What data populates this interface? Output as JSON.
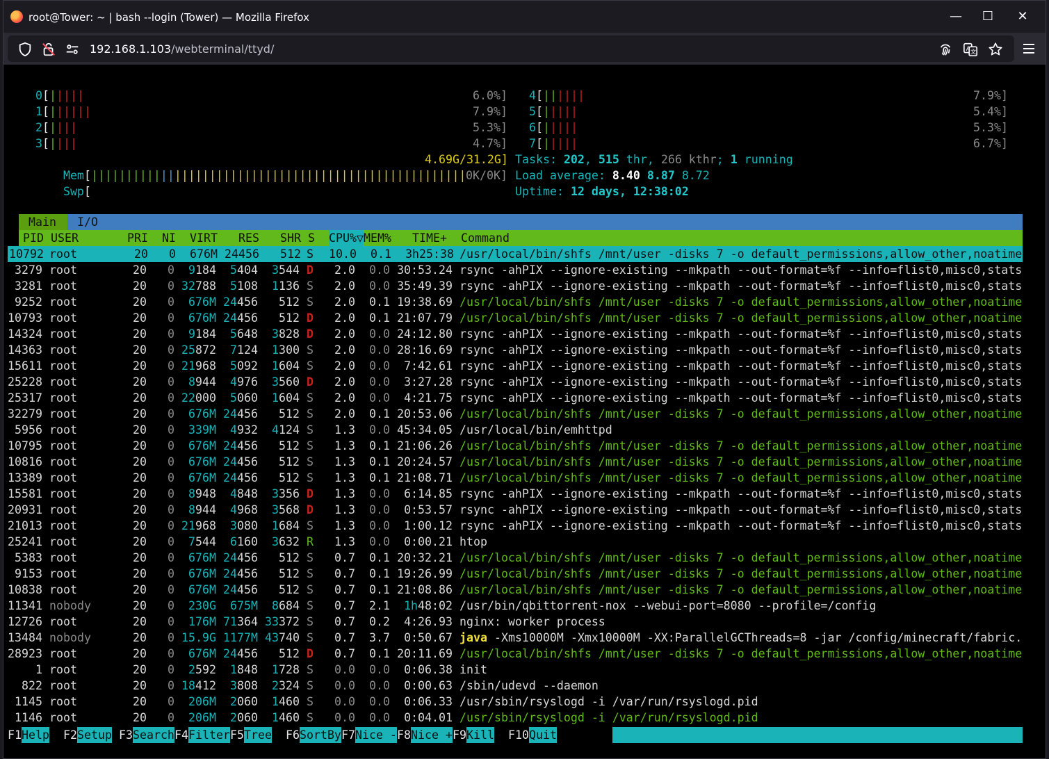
{
  "window": {
    "title": "root@Tower: ~ | bash --login (Tower) — Mozilla Firefox",
    "url_host": "192.168.1.103",
    "url_path": "/webterminal/ttyd/"
  },
  "cpus": [
    {
      "id": "0",
      "bars": [
        {
          "color": "#62b91b",
          "n": 1
        },
        {
          "color": "#c9211c",
          "n": 4
        }
      ],
      "pct": "6.0%]"
    },
    {
      "id": "1",
      "bars": [
        {
          "color": "#62b91b",
          "n": 1
        },
        {
          "color": "#c9211c",
          "n": 5
        }
      ],
      "pct": "7.9%]"
    },
    {
      "id": "2",
      "bars": [
        {
          "color": "#62b91b",
          "n": 1
        },
        {
          "color": "#c9211c",
          "n": 3
        }
      ],
      "pct": "5.3%]"
    },
    {
      "id": "3",
      "bars": [
        {
          "color": "#62b91b",
          "n": 1
        },
        {
          "color": "#c9211c",
          "n": 3
        }
      ],
      "pct": "4.7%]"
    },
    {
      "id": "4",
      "bars": [
        {
          "color": "#62b91b",
          "n": 2
        },
        {
          "color": "#c9211c",
          "n": 4
        }
      ],
      "pct": "7.9%]"
    },
    {
      "id": "5",
      "bars": [
        {
          "color": "#62b91b",
          "n": 1
        },
        {
          "color": "#c9211c",
          "n": 4
        }
      ],
      "pct": "5.4%]"
    },
    {
      "id": "6",
      "bars": [
        {
          "color": "#62b91b",
          "n": 1
        },
        {
          "color": "#c9211c",
          "n": 4
        }
      ],
      "pct": "5.3%]"
    },
    {
      "id": "7",
      "bars": [
        {
          "color": "#62b91b",
          "n": 1
        },
        {
          "color": "#c9211c",
          "n": 4
        }
      ],
      "pct": "6.7%]"
    }
  ],
  "mem": {
    "label": "Mem",
    "bars": [
      {
        "color": "#62b91b",
        "n": 10
      },
      {
        "color": "#4aa3d6",
        "n": 2
      },
      {
        "color": "#dccc1e",
        "n": 42
      }
    ],
    "value": "4.69G/31.2G]"
  },
  "swp": {
    "label": "Swp",
    "value": "0K/0K]"
  },
  "tasks": {
    "label": "Tasks: ",
    "count": "202",
    "sep1": ", ",
    "thr": "515",
    "thr_lbl": " thr, ",
    "kthr": "266 kthr",
    "sep2": "; ",
    "running": "1",
    "running_lbl": " running"
  },
  "load": {
    "label": "Load average: ",
    "v1": "8.40",
    "v2": "8.87",
    "v3": "8.72"
  },
  "uptime": {
    "label": "Uptime: ",
    "value": "12 days, 12:38:02"
  },
  "tabs": {
    "main": "Main",
    "io": "I/O"
  },
  "columns": {
    "pid": "PID",
    "user": "USER",
    "pri": "PRI",
    "ni": "NI",
    "virt": "VIRT",
    "res": "RES",
    "shr": "SHR",
    "s": "S",
    "cpu": "CPU%▽",
    "mem": "MEM%",
    "time": "TIME+",
    "command": "Command"
  },
  "processes": [
    {
      "pid": "10792",
      "user": "root",
      "pri": "20",
      "ni": "0",
      "virt": "676M",
      "res": "24456",
      "shr": "512",
      "s": "S",
      "cpu": "10.0",
      "mem": "0.1",
      "time": "3h25:38",
      "cmd": "/usr/local/bin/shfs /mnt/user -disks 7 -o default_permissions,allow_other,noatime",
      "kind": "thread",
      "selected": true
    },
    {
      "pid": "3279",
      "user": "root",
      "pri": "20",
      "ni": "0",
      "virt": "9184",
      "res": "5404",
      "shr": "3544",
      "s": "D",
      "cpu": "2.0",
      "mem": "0.0",
      "time": "30:53.24",
      "cmd": "rsync -ahPIX --ignore-existing --mkpath --out-format=%f --info=flist0,misc0,stats",
      "kind": "proc"
    },
    {
      "pid": "3281",
      "user": "root",
      "pri": "20",
      "ni": "0",
      "virt": "32788",
      "res": "5108",
      "shr": "1136",
      "s": "S",
      "cpu": "2.0",
      "mem": "0.0",
      "time": "35:49.39",
      "cmd": "rsync -ahPIX --ignore-existing --mkpath --out-format=%f --info=flist0,misc0,stats",
      "kind": "proc"
    },
    {
      "pid": "9252",
      "user": "root",
      "pri": "20",
      "ni": "0",
      "virt": "676M",
      "res": "24456",
      "shr": "512",
      "s": "S",
      "cpu": "2.0",
      "mem": "0.1",
      "time": "19:38.69",
      "cmd": "/usr/local/bin/shfs /mnt/user -disks 7 -o default_permissions,allow_other,noatime",
      "kind": "thread"
    },
    {
      "pid": "10793",
      "user": "root",
      "pri": "20",
      "ni": "0",
      "virt": "676M",
      "res": "24456",
      "shr": "512",
      "s": "D",
      "cpu": "2.0",
      "mem": "0.1",
      "time": "21:07.79",
      "cmd": "/usr/local/bin/shfs /mnt/user -disks 7 -o default_permissions,allow_other,noatime",
      "kind": "thread"
    },
    {
      "pid": "14324",
      "user": "root",
      "pri": "20",
      "ni": "0",
      "virt": "9184",
      "res": "5648",
      "shr": "3828",
      "s": "D",
      "cpu": "2.0",
      "mem": "0.0",
      "time": "24:12.80",
      "cmd": "rsync -ahPIX --ignore-existing --mkpath --out-format=%f --info=flist0,misc0,stats",
      "kind": "proc"
    },
    {
      "pid": "14363",
      "user": "root",
      "pri": "20",
      "ni": "0",
      "virt": "25872",
      "res": "7124",
      "shr": "1300",
      "s": "S",
      "cpu": "2.0",
      "mem": "0.0",
      "time": "28:16.69",
      "cmd": "rsync -ahPIX --ignore-existing --mkpath --out-format=%f --info=flist0,misc0,stats",
      "kind": "proc"
    },
    {
      "pid": "15611",
      "user": "root",
      "pri": "20",
      "ni": "0",
      "virt": "21968",
      "res": "5092",
      "shr": "1604",
      "s": "S",
      "cpu": "2.0",
      "mem": "0.0",
      "time": "7:42.61",
      "cmd": "rsync -ahPIX --ignore-existing --mkpath --out-format=%f --info=flist0,misc0,stats",
      "kind": "proc"
    },
    {
      "pid": "25228",
      "user": "root",
      "pri": "20",
      "ni": "0",
      "virt": "8944",
      "res": "4976",
      "shr": "3560",
      "s": "D",
      "cpu": "2.0",
      "mem": "0.0",
      "time": "3:27.28",
      "cmd": "rsync -ahPIX --ignore-existing --mkpath --out-format=%f --info=flist0,misc0,stats",
      "kind": "proc"
    },
    {
      "pid": "25317",
      "user": "root",
      "pri": "20",
      "ni": "0",
      "virt": "22000",
      "res": "5060",
      "shr": "1604",
      "s": "S",
      "cpu": "2.0",
      "mem": "0.0",
      "time": "4:21.75",
      "cmd": "rsync -ahPIX --ignore-existing --mkpath --out-format=%f --info=flist0,misc0,stats",
      "kind": "proc"
    },
    {
      "pid": "32279",
      "user": "root",
      "pri": "20",
      "ni": "0",
      "virt": "676M",
      "res": "24456",
      "shr": "512",
      "s": "S",
      "cpu": "2.0",
      "mem": "0.1",
      "time": "20:53.06",
      "cmd": "/usr/local/bin/shfs /mnt/user -disks 7 -o default_permissions,allow_other,noatime",
      "kind": "thread"
    },
    {
      "pid": "5956",
      "user": "root",
      "pri": "20",
      "ni": "0",
      "virt": "339M",
      "res": "4932",
      "shr": "4124",
      "s": "S",
      "cpu": "1.3",
      "mem": "0.0",
      "time": "45:34.05",
      "cmd": "/usr/local/bin/emhttpd",
      "kind": "proc"
    },
    {
      "pid": "10795",
      "user": "root",
      "pri": "20",
      "ni": "0",
      "virt": "676M",
      "res": "24456",
      "shr": "512",
      "s": "S",
      "cpu": "1.3",
      "mem": "0.1",
      "time": "21:06.26",
      "cmd": "/usr/local/bin/shfs /mnt/user -disks 7 -o default_permissions,allow_other,noatime",
      "kind": "thread"
    },
    {
      "pid": "10816",
      "user": "root",
      "pri": "20",
      "ni": "0",
      "virt": "676M",
      "res": "24456",
      "shr": "512",
      "s": "S",
      "cpu": "1.3",
      "mem": "0.1",
      "time": "20:24.57",
      "cmd": "/usr/local/bin/shfs /mnt/user -disks 7 -o default_permissions,allow_other,noatime",
      "kind": "thread"
    },
    {
      "pid": "13389",
      "user": "root",
      "pri": "20",
      "ni": "0",
      "virt": "676M",
      "res": "24456",
      "shr": "512",
      "s": "S",
      "cpu": "1.3",
      "mem": "0.1",
      "time": "21:08.71",
      "cmd": "/usr/local/bin/shfs /mnt/user -disks 7 -o default_permissions,allow_other,noatime",
      "kind": "thread"
    },
    {
      "pid": "15581",
      "user": "root",
      "pri": "20",
      "ni": "0",
      "virt": "8948",
      "res": "4848",
      "shr": "3356",
      "s": "D",
      "cpu": "1.3",
      "mem": "0.0",
      "time": "6:14.85",
      "cmd": "rsync -ahPIX --ignore-existing --mkpath --out-format=%f --info=flist0,misc0,stats",
      "kind": "proc"
    },
    {
      "pid": "20931",
      "user": "root",
      "pri": "20",
      "ni": "0",
      "virt": "8944",
      "res": "4968",
      "shr": "3568",
      "s": "D",
      "cpu": "1.3",
      "mem": "0.0",
      "time": "0:53.57",
      "cmd": "rsync -ahPIX --ignore-existing --mkpath --out-format=%f --info=flist0,misc0,stats",
      "kind": "proc"
    },
    {
      "pid": "21013",
      "user": "root",
      "pri": "20",
      "ni": "0",
      "virt": "21968",
      "res": "3080",
      "shr": "1684",
      "s": "S",
      "cpu": "1.3",
      "mem": "0.0",
      "time": "1:00.12",
      "cmd": "rsync -ahPIX --ignore-existing --mkpath --out-format=%f --info=flist0,misc0,stats",
      "kind": "proc"
    },
    {
      "pid": "25241",
      "user": "root",
      "pri": "20",
      "ni": "0",
      "virt": "7544",
      "res": "6160",
      "shr": "3632",
      "s": "R",
      "cpu": "1.3",
      "mem": "0.0",
      "time": "0:00.21",
      "cmd": "htop",
      "kind": "proc"
    },
    {
      "pid": "5383",
      "user": "root",
      "pri": "20",
      "ni": "0",
      "virt": "676M",
      "res": "24456",
      "shr": "512",
      "s": "S",
      "cpu": "0.7",
      "mem": "0.1",
      "time": "20:32.21",
      "cmd": "/usr/local/bin/shfs /mnt/user -disks 7 -o default_permissions,allow_other,noatime",
      "kind": "thread"
    },
    {
      "pid": "9153",
      "user": "root",
      "pri": "20",
      "ni": "0",
      "virt": "676M",
      "res": "24456",
      "shr": "512",
      "s": "S",
      "cpu": "0.7",
      "mem": "0.1",
      "time": "19:26.99",
      "cmd": "/usr/local/bin/shfs /mnt/user -disks 7 -o default_permissions,allow_other,noatime",
      "kind": "thread"
    },
    {
      "pid": "10838",
      "user": "root",
      "pri": "20",
      "ni": "0",
      "virt": "676M",
      "res": "24456",
      "shr": "512",
      "s": "S",
      "cpu": "0.7",
      "mem": "0.1",
      "time": "21:08.86",
      "cmd": "/usr/local/bin/shfs /mnt/user -disks 7 -o default_permissions,allow_other,noatime",
      "kind": "thread"
    },
    {
      "pid": "11341",
      "user": "nobody",
      "pri": "20",
      "ni": "0",
      "virt": "230G",
      "res": "675M",
      "shr": "8684",
      "s": "S",
      "cpu": "0.7",
      "mem": "2.1",
      "time": "1h48:02",
      "cmd": "/usr/bin/qbittorrent-nox --webui-port=8080 --profile=/config",
      "kind": "proc"
    },
    {
      "pid": "12726",
      "user": "root",
      "pri": "20",
      "ni": "0",
      "virt": "176M",
      "res": "71364",
      "shr": "33372",
      "s": "S",
      "cpu": "0.7",
      "mem": "0.2",
      "time": "4:26.93",
      "cmd": "nginx: worker process",
      "kind": "proc"
    },
    {
      "pid": "13484",
      "user": "nobody",
      "pri": "20",
      "ni": "0",
      "virt": "15.9G",
      "res": "1177M",
      "shr": "43740",
      "s": "S",
      "cpu": "0.7",
      "mem": "3.7",
      "time": "0:50.67",
      "cmd": "java",
      "cmd_rest": " -Xms10000M -Xmx10000M -XX:ParallelGCThreads=8 -jar /config/minecraft/fabric.",
      "kind": "java"
    },
    {
      "pid": "28923",
      "user": "root",
      "pri": "20",
      "ni": "0",
      "virt": "676M",
      "res": "24456",
      "shr": "512",
      "s": "D",
      "cpu": "0.7",
      "mem": "0.1",
      "time": "20:11.69",
      "cmd": "/usr/local/bin/shfs /mnt/user -disks 7 -o default_permissions,allow_other,noatime",
      "kind": "thread"
    },
    {
      "pid": "1",
      "user": "root",
      "pri": "20",
      "ni": "0",
      "virt": "2592",
      "res": "1848",
      "shr": "1728",
      "s": "S",
      "cpu": "0.0",
      "mem": "0.0",
      "time": "0:06.38",
      "cmd": "init",
      "kind": "proc"
    },
    {
      "pid": "822",
      "user": "root",
      "pri": "20",
      "ni": "0",
      "virt": "18412",
      "res": "3808",
      "shr": "2324",
      "s": "S",
      "cpu": "0.0",
      "mem": "0.0",
      "time": "0:00.63",
      "cmd": "/sbin/udevd --daemon",
      "kind": "proc"
    },
    {
      "pid": "1145",
      "user": "root",
      "pri": "20",
      "ni": "0",
      "virt": "206M",
      "res": "2060",
      "shr": "1460",
      "s": "S",
      "cpu": "0.0",
      "mem": "0.0",
      "time": "0:06.33",
      "cmd": "/usr/sbin/rsyslogd -i /var/run/rsyslogd.pid",
      "kind": "proc"
    },
    {
      "pid": "1146",
      "user": "root",
      "pri": "20",
      "ni": "0",
      "virt": "206M",
      "res": "2060",
      "shr": "1460",
      "s": "S",
      "cpu": "0.0",
      "mem": "0.0",
      "time": "0:04.01",
      "cmd": "/usr/sbin/rsyslogd -i /var/run/rsyslogd.pid",
      "kind": "thread"
    }
  ],
  "footer": [
    {
      "key": "F1",
      "label": "Help  "
    },
    {
      "key": "F2",
      "label": "Setup "
    },
    {
      "key": "F3",
      "label": "Search"
    },
    {
      "key": "F4",
      "label": "Filter"
    },
    {
      "key": "F5",
      "label": "Tree  "
    },
    {
      "key": "F6",
      "label": "SortBy"
    },
    {
      "key": "F7",
      "label": "Nice -"
    },
    {
      "key": "F8",
      "label": "Nice +"
    },
    {
      "key": "F9",
      "label": "Kill  "
    },
    {
      "key": "F10",
      "label": "Quit"
    }
  ],
  "colors": {
    "green": "#62b91b",
    "cyan": "#19b3b8",
    "red": "#c9211c",
    "blue": "#4aa3d6",
    "yellow": "#dccc1e"
  },
  "icons": [
    "firefox-logo",
    "shield-icon",
    "insecure-lock-icon",
    "site-info-icon",
    "fingerprint-icon",
    "translate-icon",
    "bookmark-star-icon",
    "menu-icon",
    "minimize-icon",
    "maximize-icon",
    "close-icon"
  ]
}
